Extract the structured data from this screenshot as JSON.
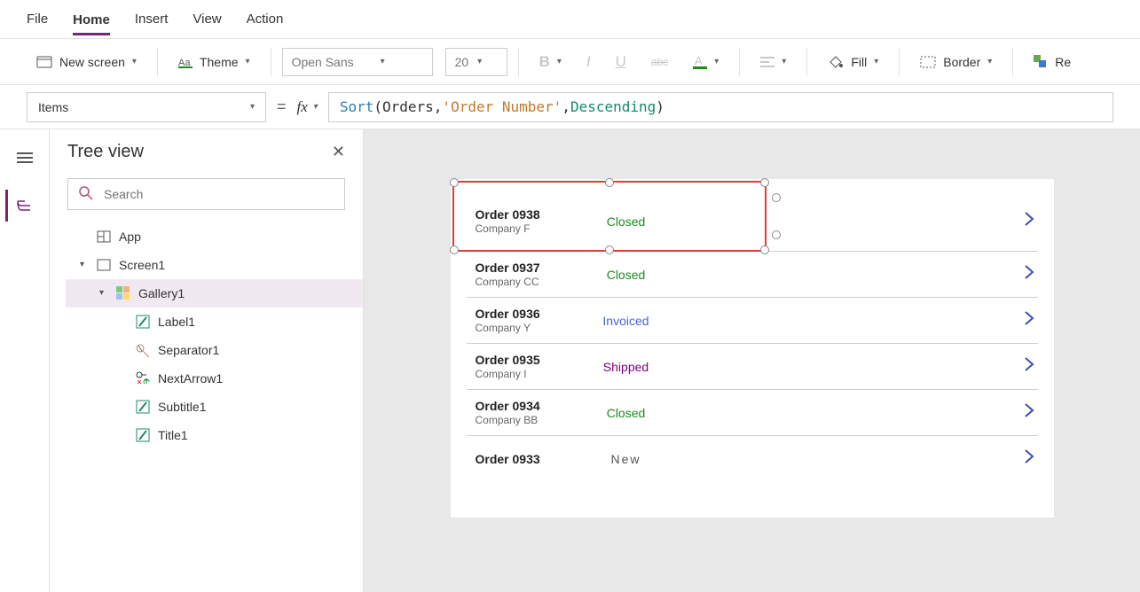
{
  "menu": {
    "items": [
      "File",
      "Home",
      "Insert",
      "View",
      "Action"
    ],
    "active": "Home"
  },
  "ribbon": {
    "new_screen": "New screen",
    "theme": "Theme",
    "font_family": "Open Sans",
    "font_size": "20",
    "fill": "Fill",
    "border": "Border",
    "reorder": "Re"
  },
  "formula": {
    "property": "Items",
    "tokens": [
      "Sort",
      "( ",
      " Orders",
      ", ",
      "'Order Number'",
      ", ",
      "Descending",
      " )"
    ]
  },
  "tree": {
    "title": "Tree view",
    "search_placeholder": "Search",
    "nodes": [
      {
        "depth": 0,
        "label": "App",
        "icon": "app",
        "caret": ""
      },
      {
        "depth": 0,
        "label": "Screen1",
        "icon": "screen",
        "caret": "▾"
      },
      {
        "depth": 1,
        "label": "Gallery1",
        "icon": "gallery",
        "caret": "▾",
        "selected": true
      },
      {
        "depth": 2,
        "label": "Label1",
        "icon": "label",
        "caret": ""
      },
      {
        "depth": 2,
        "label": "Separator1",
        "icon": "separator",
        "caret": ""
      },
      {
        "depth": 2,
        "label": "NextArrow1",
        "icon": "nextarrow",
        "caret": ""
      },
      {
        "depth": 2,
        "label": "Subtitle1",
        "icon": "label",
        "caret": ""
      },
      {
        "depth": 2,
        "label": "Title1",
        "icon": "label",
        "caret": ""
      }
    ]
  },
  "gallery": [
    {
      "title": "Order 0938",
      "subtitle": "Company F",
      "status": "Closed"
    },
    {
      "title": "Order 0937",
      "subtitle": "Company CC",
      "status": "Closed"
    },
    {
      "title": "Order 0936",
      "subtitle": "Company Y",
      "status": "Invoiced"
    },
    {
      "title": "Order 0935",
      "subtitle": "Company I",
      "status": "Shipped"
    },
    {
      "title": "Order 0934",
      "subtitle": "Company BB",
      "status": "Closed"
    },
    {
      "title": "Order 0933",
      "subtitle": "",
      "status": "New"
    }
  ]
}
